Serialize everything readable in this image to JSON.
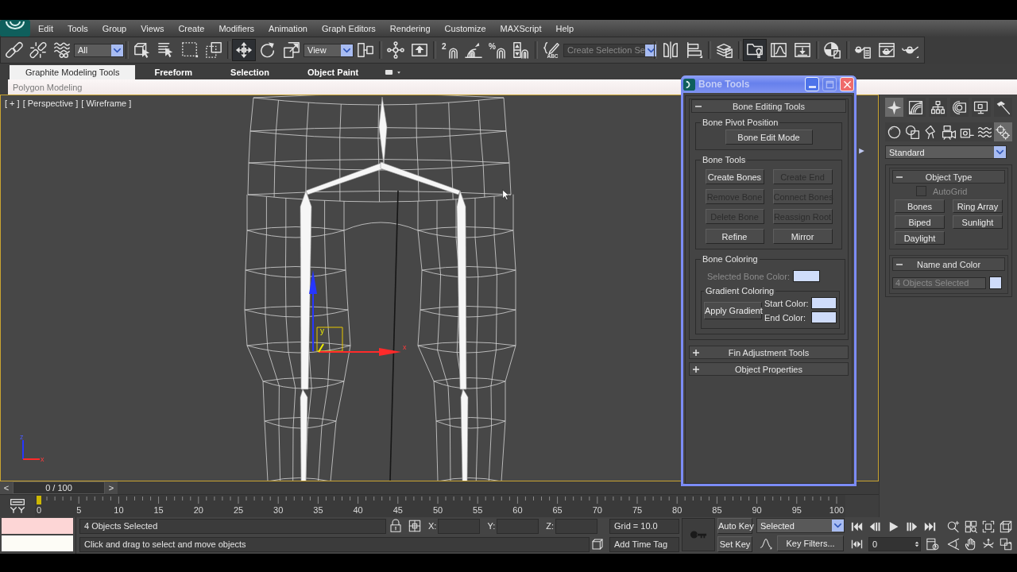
{
  "menu_bar": {
    "items": [
      "Edit",
      "Tools",
      "Group",
      "Views",
      "Create",
      "Modifiers",
      "Animation",
      "Graph Editors",
      "Rendering",
      "Customize",
      "MAXScript",
      "Help"
    ]
  },
  "main_toolbar": {
    "groups": [
      [
        {
          "kind": "link",
          "active": false
        },
        {
          "kind": "unlink",
          "active": false
        },
        {
          "kind": "bindwarp",
          "active": false
        },
        {
          "kind": "dropdown",
          "value": "All"
        }
      ],
      [
        {
          "kind": "select",
          "active": false
        },
        {
          "kind": "byname",
          "active": false
        },
        {
          "kind": "region",
          "active": false
        },
        {
          "kind": "crossing",
          "active": false
        }
      ],
      [
        {
          "kind": "move",
          "active": true
        },
        {
          "kind": "rotate",
          "active": false
        },
        {
          "kind": "scale",
          "active": false
        },
        {
          "kind": "dropdown",
          "value": "View"
        },
        {
          "kind": "pivot",
          "active": false
        }
      ],
      [
        {
          "kind": "manipulate",
          "active": false
        },
        {
          "kind": "override",
          "active": false
        }
      ],
      [
        {
          "kind": "snap",
          "glyph": "2",
          "active": false
        },
        {
          "kind": "anglesnap",
          "active": false
        },
        {
          "kind": "percentsnap",
          "glyph": "%",
          "active": false
        },
        {
          "kind": "spinnersnap",
          "active": false
        }
      ],
      [
        {
          "kind": "editnamed",
          "glyph": "ABC",
          "active": false
        },
        {
          "kind": "combo",
          "placeholder": "Create Selection Se"
        }
      ],
      [
        {
          "kind": "mirror",
          "active": false
        },
        {
          "kind": "align",
          "active": false
        }
      ],
      [
        {
          "kind": "layers",
          "active": false
        }
      ],
      [
        {
          "kind": "explorer",
          "active": true
        },
        {
          "kind": "curves",
          "active": false
        },
        {
          "kind": "schematic",
          "active": false
        }
      ],
      [
        {
          "kind": "material",
          "active": false
        }
      ],
      [
        {
          "kind": "rendersetup",
          "active": false
        },
        {
          "kind": "framewindow",
          "active": false
        },
        {
          "kind": "render",
          "active": false
        }
      ]
    ]
  },
  "ribbon": {
    "tabs": [
      {
        "label": "Graphite Modeling Tools",
        "selected": true
      },
      {
        "label": "Freeform",
        "selected": false
      },
      {
        "label": "Selection",
        "selected": false
      },
      {
        "label": "Object Paint",
        "selected": false
      }
    ],
    "panel_label": "Polygon Modeling"
  },
  "viewport": {
    "labels": [
      "[ + ]",
      "[ Perspective ]",
      "[ Wireframe ]"
    ],
    "active": true,
    "gizmo_labels": [
      "y",
      "x"
    ],
    "tripod_labels": [
      "z",
      "x"
    ]
  },
  "bone_tools_dialog": {
    "title": "Bone Tools",
    "window_buttons": [
      {
        "kind": "minimize",
        "disabled": false
      },
      {
        "kind": "maximize",
        "disabled": true
      },
      {
        "kind": "close",
        "disabled": false
      }
    ],
    "rollouts": [
      {
        "title": "Bone Editing Tools",
        "expanded": true,
        "groups": [
          {
            "kind": "single",
            "title": "Bone Pivot Position",
            "buttons": [
              {
                "label": "Bone Edit Mode",
                "disabled": false
              }
            ]
          },
          {
            "kind": "grid",
            "title": "Bone Tools",
            "buttons": [
              {
                "label": "Create Bones",
                "disabled": false
              },
              {
                "label": "Create End",
                "disabled": true
              },
              {
                "label": "Remove Bone",
                "disabled": true
              },
              {
                "label": "Connect Bones",
                "disabled": true
              },
              {
                "label": "Delete Bone",
                "disabled": true
              },
              {
                "label": "Reassign Root",
                "disabled": true
              },
              {
                "label": "Refine",
                "disabled": false
              },
              {
                "label": "Mirror",
                "disabled": false
              }
            ]
          },
          {
            "kind": "coloring",
            "title": "Bone Coloring",
            "swatch": {
              "label": "Selected Bone Color:",
              "disabled": true,
              "color": "#cfdcfa"
            },
            "gradient": {
              "title": "Gradient Coloring",
              "button": "Apply Gradient",
              "swatches": [
                {
                  "label": "Start Color:",
                  "color": "#cfdcfa"
                },
                {
                  "label": "End Color:",
                  "color": "#cfdcfa"
                }
              ]
            }
          }
        ]
      },
      {
        "title": "Fin Adjustment Tools",
        "expanded": false
      },
      {
        "title": "Object Properties",
        "expanded": false
      }
    ]
  },
  "command_panel": {
    "tabs": [
      {
        "kind": "create",
        "selected": true
      },
      {
        "kind": "modify",
        "selected": false
      },
      {
        "kind": "hierarchy",
        "selected": false
      },
      {
        "kind": "motion",
        "selected": false
      },
      {
        "kind": "display",
        "selected": false
      },
      {
        "kind": "utilities",
        "selected": false
      }
    ],
    "categories": [
      {
        "kind": "geometry",
        "selected": false
      },
      {
        "kind": "shapes",
        "selected": false
      },
      {
        "kind": "lights",
        "selected": false
      },
      {
        "kind": "cameras",
        "selected": false
      },
      {
        "kind": "helpers",
        "selected": false
      },
      {
        "kind": "spacewarps",
        "selected": false
      },
      {
        "kind": "systems",
        "selected": true
      }
    ],
    "subcategory": "Standard",
    "rollouts": [
      {
        "kind": "object_type",
        "title": "Object Type",
        "expanded": true,
        "autogrid": {
          "label": "AutoGrid",
          "checked": false,
          "disabled": true
        },
        "buttons": [
          {
            "label": "Bones",
            "selected": false
          },
          {
            "label": "Ring Array",
            "selected": false
          },
          {
            "label": "Biped",
            "selected": false
          },
          {
            "label": "Sunlight",
            "selected": false
          },
          {
            "label": "Daylight",
            "selected": false
          }
        ]
      },
      {
        "kind": "name_color",
        "title": "Name and Color",
        "expanded": true,
        "name": {
          "value": "4 Objects Selected",
          "disabled": true
        },
        "color": "#cfdcfa"
      }
    ]
  },
  "time_slider": {
    "prev": "<",
    "position": "0 / 100",
    "next": ">"
  },
  "track_bar": {
    "labels": [
      "0",
      "5",
      "10",
      "15",
      "20",
      "25",
      "30",
      "35",
      "40",
      "45",
      "50",
      "55",
      "60",
      "65",
      "70",
      "75",
      "80",
      "85",
      "90",
      "95",
      "100"
    ],
    "level": 0
  },
  "status_bar": {
    "selection_info": "4 Objects Selected",
    "prompt": "Click and drag to select and move objects",
    "coordinate_labels": [
      "X:",
      "Y:",
      "Z:"
    ],
    "grid": "Grid = 10.0",
    "time_tag": "Add Time Tag",
    "auto_key": {
      "label": "Auto Key",
      "on": false
    },
    "set_key": "Set Key",
    "key_mode": "Selected",
    "key_filters": "Key Filters...",
    "current_frame": "0"
  }
}
